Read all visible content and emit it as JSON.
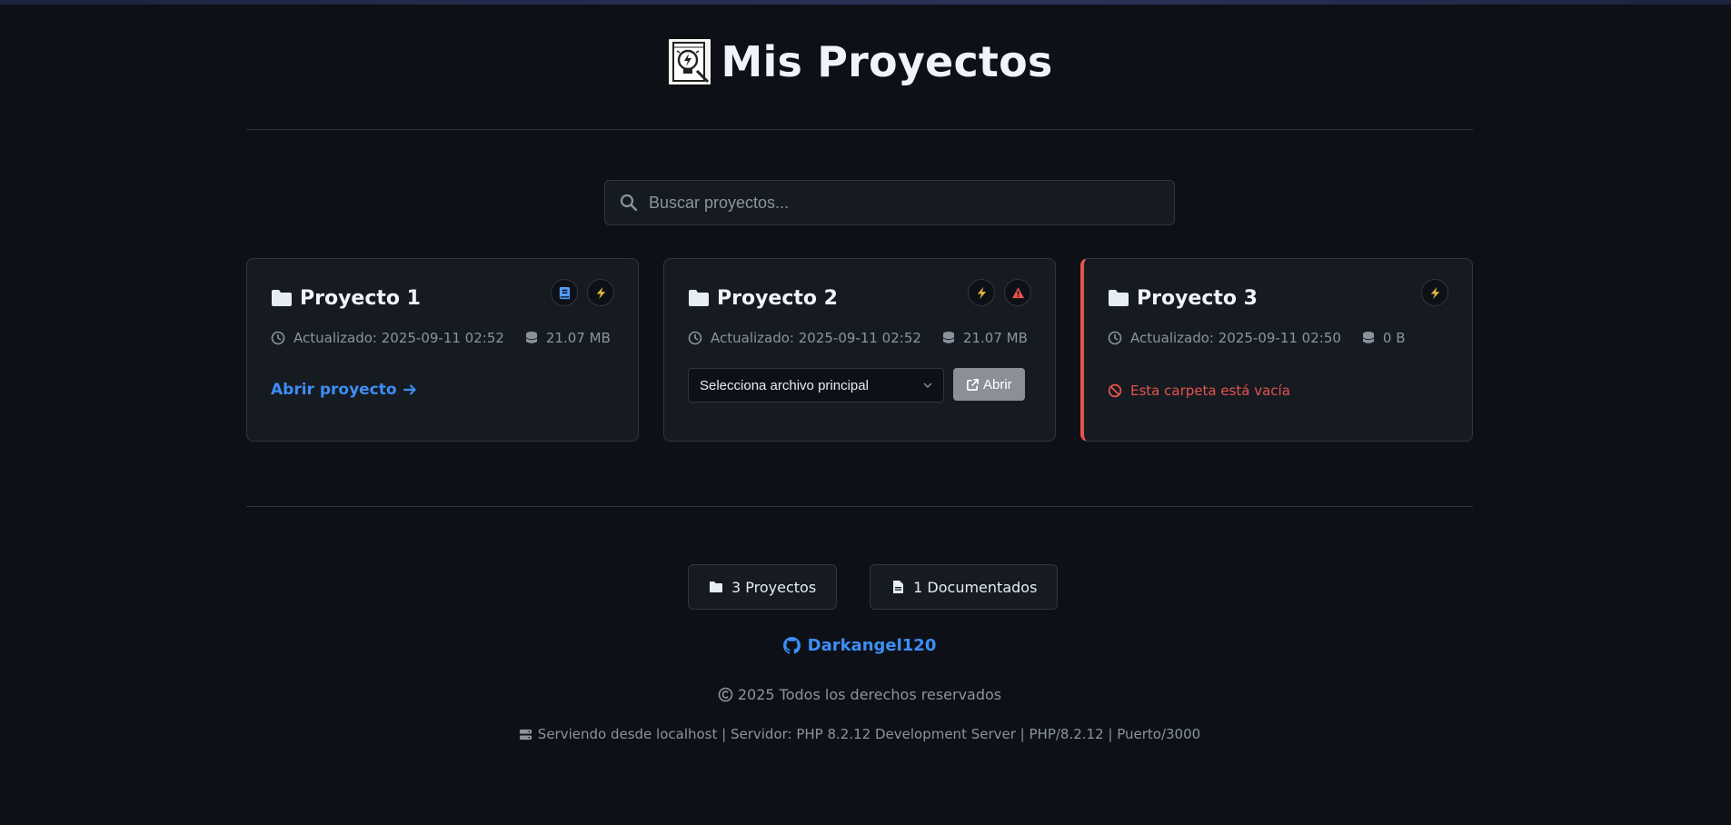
{
  "header": {
    "title": "Mis Proyectos",
    "logo_icon": "lightbulb-notebook-icon"
  },
  "search": {
    "placeholder": "Buscar proyectos...",
    "value": ""
  },
  "projects": [
    {
      "name": "Proyecto 1",
      "updated": "Actualizado: 2025-09-11 02:52",
      "size": "21.07 MB",
      "badges": [
        "book-icon",
        "bolt-icon"
      ],
      "action_label": "Abrir proyecto"
    },
    {
      "name": "Proyecto 2",
      "updated": "Actualizado: 2025-09-11 02:52",
      "size": "21.07 MB",
      "badges": [
        "bolt-icon",
        "warning-icon"
      ],
      "select_value": "Selecciona archivo principal",
      "button_label": "Abrir"
    },
    {
      "name": "Proyecto 3",
      "updated": "Actualizado: 2025-09-11 02:50",
      "size": "0 B",
      "badges": [
        "bolt-icon"
      ],
      "empty_message": "Esta carpeta está vacía"
    }
  ],
  "footer": {
    "projects_count": "3 Proyectos",
    "documented_count": "1 Documentados",
    "github_user": "Darkangel120",
    "copyright": "2025 Todos los derechos reservados",
    "server_info": "Serviendo desde localhost | Servidor: PHP 8.2.12 Development Server | PHP/8.2.12 | Puerto/3000"
  },
  "colors": {
    "background": "#0d1117",
    "card": "#161b22",
    "border": "#30363d",
    "accent": "#3d8ef5",
    "bolt": "#e3b341",
    "danger": "#e5534b",
    "muted": "#8b949e"
  }
}
